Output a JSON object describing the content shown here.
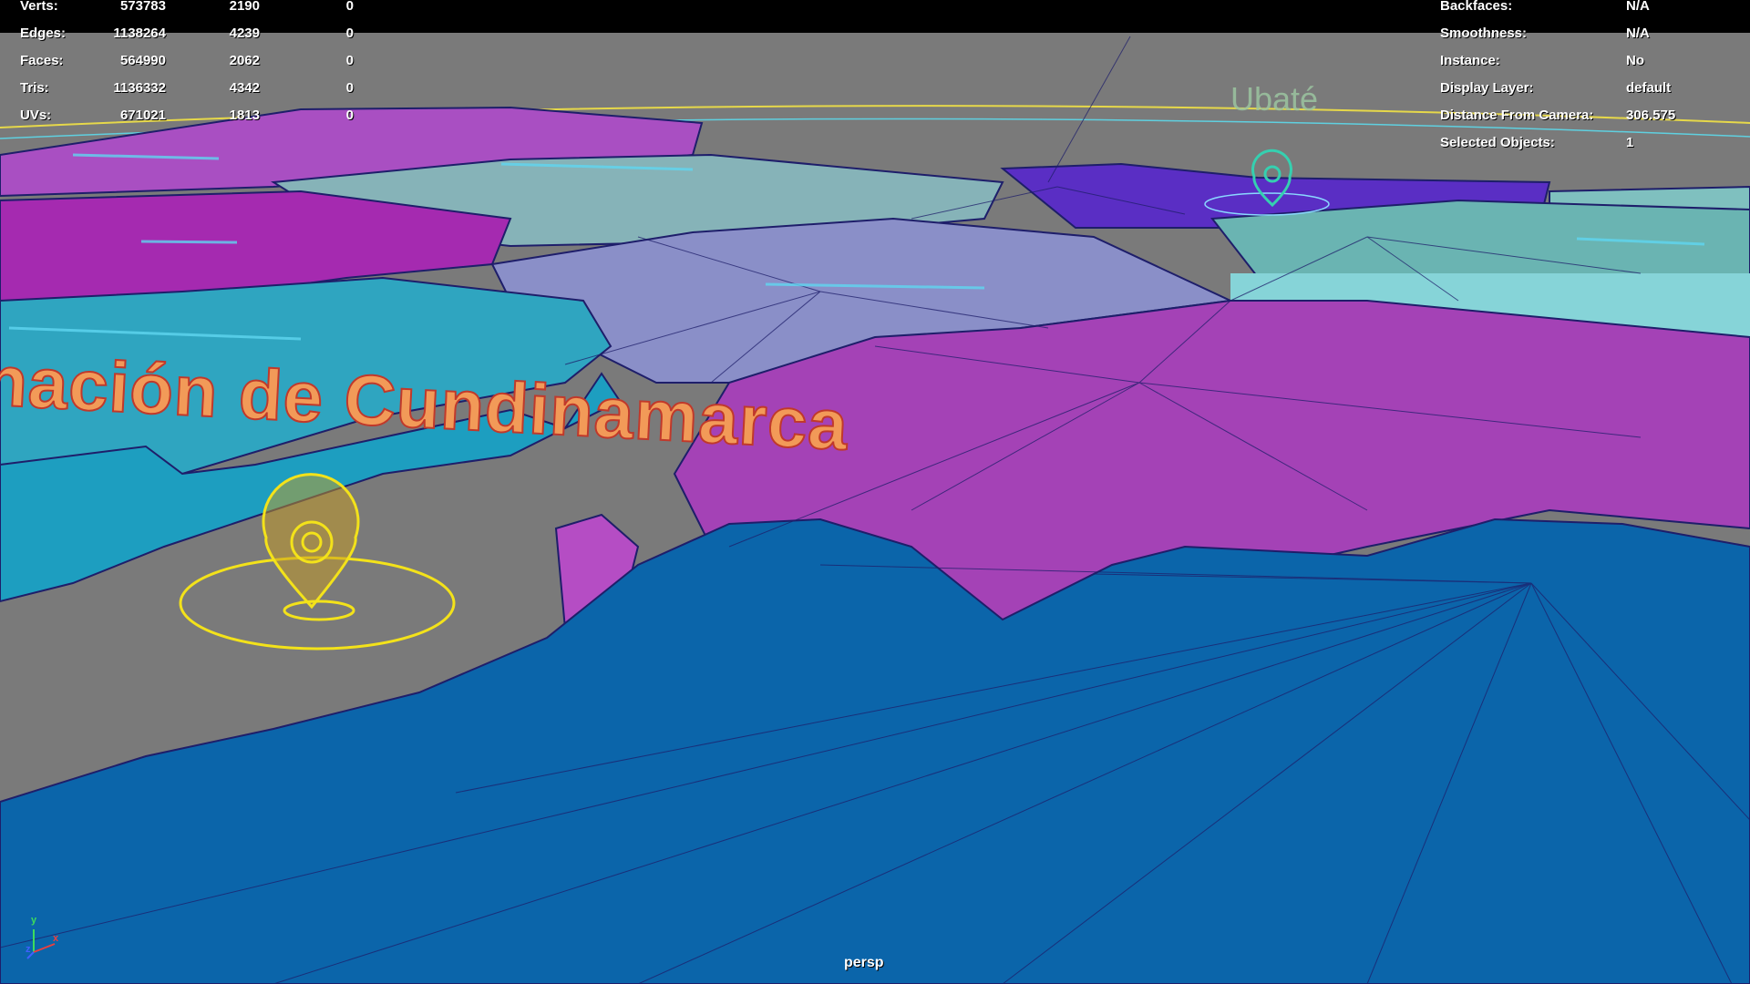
{
  "viewport": {
    "camera": "persp",
    "labels": {
      "big_text": "nación de Cundinamarca",
      "town": "Ubaté"
    },
    "markers": [
      {
        "name": "location-marker",
        "color": "#f3e21a"
      },
      {
        "name": "location-marker",
        "color": "#35d0b0"
      }
    ],
    "colors": {
      "background": "#7a7a7a",
      "blue_region": "#0a64a8",
      "magenta_region": "#a03bbf",
      "cyan_region": "#2ab0c8",
      "lavender_region": "#8a8fc8",
      "teal_region": "#5fb0b0",
      "wireframe": "#1e1e6a",
      "selection": "#f3e21a"
    }
  },
  "hud": {
    "poly_count": [
      {
        "label": "Verts:",
        "values": [
          "573783",
          "2190",
          "0"
        ]
      },
      {
        "label": "Edges:",
        "values": [
          "1138264",
          "4239",
          "0"
        ]
      },
      {
        "label": "Faces:",
        "values": [
          "564990",
          "2062",
          "0"
        ]
      },
      {
        "label": "Tris:",
        "values": [
          "1136332",
          "4342",
          "0"
        ]
      },
      {
        "label": "UVs:",
        "values": [
          "671021",
          "1813",
          "0"
        ]
      }
    ],
    "object_info": [
      {
        "label": "Backfaces:",
        "value": "N/A"
      },
      {
        "label": "Smoothness:",
        "value": "N/A"
      },
      {
        "label": "Instance:",
        "value": "No"
      },
      {
        "label": "Display Layer:",
        "value": "default"
      },
      {
        "label": "Distance From Camera:",
        "value": "306.575"
      },
      {
        "label": "Selected Objects:",
        "value": "1"
      }
    ]
  },
  "axis_gizmo": {
    "x": "x",
    "y": "y",
    "z": "z"
  }
}
